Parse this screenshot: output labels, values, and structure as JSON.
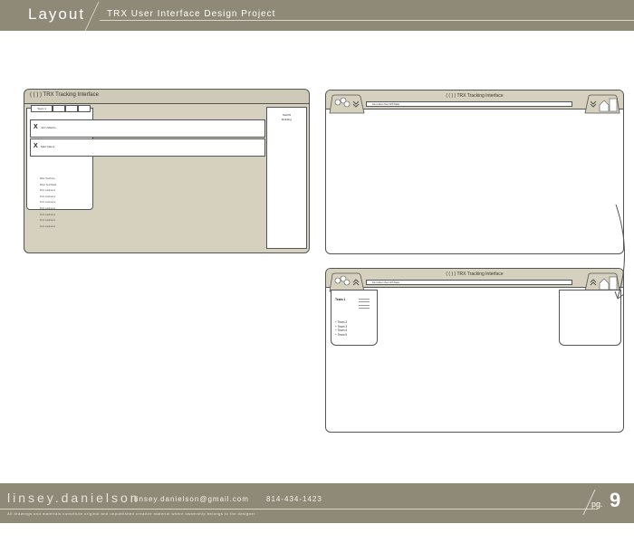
{
  "header": {
    "title": "Layout",
    "subtitle": "TRX User Interface Design Project"
  },
  "mockup1": {
    "title": "( (   ) )  TRX Tracking Interface",
    "tabs": [
      "Team 1",
      "",
      "",
      ""
    ],
    "cards": [
      {
        "mark": "X",
        "name": "John Mastro"
      },
      {
        "mark": "X",
        "name": "Matt Gianni"
      }
    ],
    "names": [
      "Mike Smithson",
      "Brian Smithfield",
      "First Lastname",
      "First Lastname",
      "First Lastname",
      "First Lastname",
      "First Lastname",
      "First Lastname",
      "First Lastname"
    ],
    "right_panel": [
      "SHOW",
      "Building"
    ]
  },
  "mockup2": {
    "title": "( (   ) )  TRX Tracking Interface",
    "tabbar": "File   Incident View   GPS   Radio"
  },
  "mockup3": {
    "title": "( (   ) )  TRX Tracking Interface",
    "tabbar": "File   Incident View   GPS   Radio",
    "team_head": "Team 1",
    "team_list": [
      "+ Team 2",
      "+ Team 3",
      "+ Team 4",
      "+ Team 5"
    ]
  },
  "footer": {
    "name": "linsey.danielson",
    "email": "linsey.danielson@gmail.com",
    "phone": "814-434-1423",
    "note": "All drawings and materials constitute original and unpublished creative material where ownership belongs to the designer.",
    "page_label": "pg.",
    "page_number": "9"
  }
}
